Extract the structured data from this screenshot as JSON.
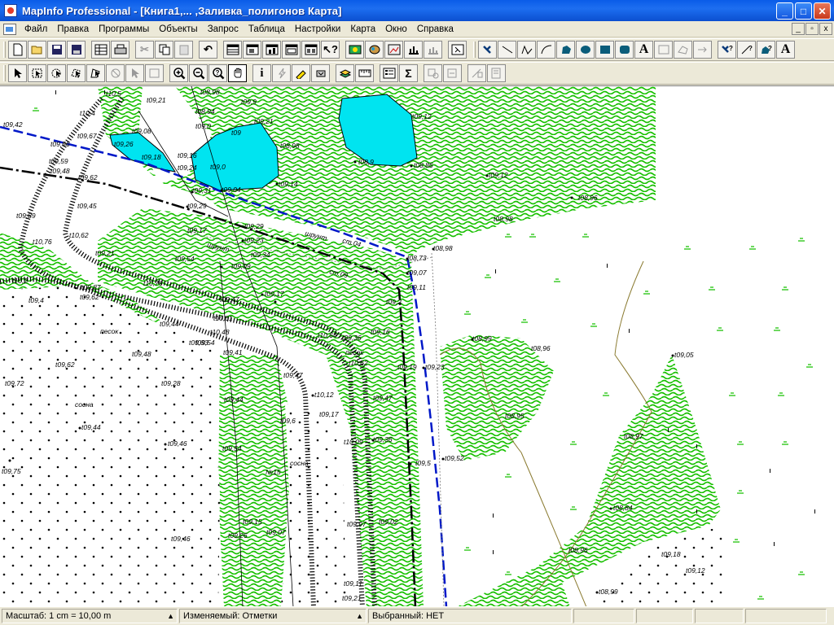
{
  "window": {
    "title": "MapInfo Professional - [Книга1,... ,Заливка_полигонов Карта]",
    "minimize": "_",
    "maximize": "□",
    "close": "✕"
  },
  "menu": {
    "items": [
      "Файл",
      "Правка",
      "Программы",
      "Объекты",
      "Запрос",
      "Таблица",
      "Настройки",
      "Карта",
      "Окно",
      "Справка"
    ],
    "mdi_minimize": "_",
    "mdi_restore": "▫",
    "mdi_close": "x"
  },
  "toolbar_main": {
    "buttons": [
      "new-icon",
      "open-icon",
      "save-icon",
      "save-workspace-icon",
      "browse-icon",
      "print-icon",
      "cut-icon",
      "copy-icon",
      "paste-icon",
      "undo-icon",
      "new-browser-icon",
      "new-mapper-icon",
      "new-grapher-icon",
      "new-layout-icon",
      "new-redistrict-icon",
      "help-pointer-icon",
      "hotlink-icon",
      "theme-icon",
      "toggle-icon",
      "stats-icon",
      "graph-icon",
      "show-icon"
    ],
    "drawing_buttons": [
      "symbol-icon",
      "line-icon",
      "polyline-icon",
      "arc-icon",
      "polygon-icon",
      "ellipse-icon",
      "rectangle-icon",
      "rounded-rect-icon",
      "text-icon",
      "frame-icon",
      "reshape-icon",
      "add-node-icon",
      "symbol-style-icon",
      "line-style-icon",
      "region-style-icon",
      "text-style-icon"
    ],
    "text_glyph": "A",
    "text_style_glyph": "A"
  },
  "toolbar_map": {
    "info_glyph": "i",
    "sigma_glyph": "Σ"
  },
  "map": {
    "labels": [
      "t10,5",
      "t10,4",
      "t09,21",
      "t09,08",
      "t09,26",
      "t09,18",
      "t09,16",
      "t09,24",
      "t09,0",
      "t09,42",
      "t09,56",
      "t09,67",
      "t09,59",
      "t09,48",
      "t09,62",
      "t09,45",
      "t09,89",
      "t10,76",
      "t10,62",
      "t09,21",
      "t10,2",
      "t09,4",
      "t09,87",
      "t09,62",
      "t10,76",
      "t09,31",
      "t09,29",
      "t09,17",
      "t09,04",
      "t09,14",
      "t09,21",
      "t08,98",
      "t09,9",
      "t08,94",
      "t09,0",
      "t08,98",
      "t09",
      "t09,12",
      "t08,9",
      "t08,86",
      "t09,12",
      "t08,96",
      "t08,98",
      "t08,98",
      "t08,73",
      "t09,07",
      "t09,11",
      "t09,2",
      "t09,29",
      "t09,23",
      "t09,34",
      "t09,09",
      "t09,54",
      "t09,17",
      "t09,47",
      "t10,61",
      "t10,48",
      "t09,44",
      "t09,33",
      "t09,36",
      "t09,16",
      "t09,23",
      "t10,62",
      "t09,19",
      "t08,99",
      "t08,96",
      "t09,05",
      "t10,64",
      "t09,54",
      "t09,48",
      "t09,62",
      "t09,28",
      "t09,72",
      "t09,44",
      "t09,46",
      "t09,41",
      "t09,47",
      "t10,12",
      "t09,17",
      "t09,47",
      "t09,6",
      "t10,09",
      "t09,44",
      "t09,54",
      "t09,36",
      "t09,5",
      "t09,52",
      "t08,95",
      "t08,97",
      "t08,84",
      "t09,02",
      "t09,97",
      "t09,15",
      "t09,07",
      "t09,46",
      "t09,26",
      "t09,11",
      "t09,21",
      "t08,96",
      "t08,99",
      "t09,18",
      "t09,12",
      "t09,75",
      "песок",
      "песок",
      "сосна",
      "сосна",
      "шрунт",
      "шрунт",
      "№15",
      "ст.04",
      "ст.09"
    ]
  },
  "status": {
    "scale": "Масштаб: 1 cm = 10,00 m",
    "editable": "Изменяемый: Отметки",
    "selected": "Выбранный: НЕТ",
    "dropdown_arrow": "▲"
  },
  "colors": {
    "titlebar": "#0a5ce8",
    "water": "#00e4f0",
    "vegetation": "#17c000",
    "road_blue": "#0018c8",
    "trail": "#8a7a30"
  }
}
